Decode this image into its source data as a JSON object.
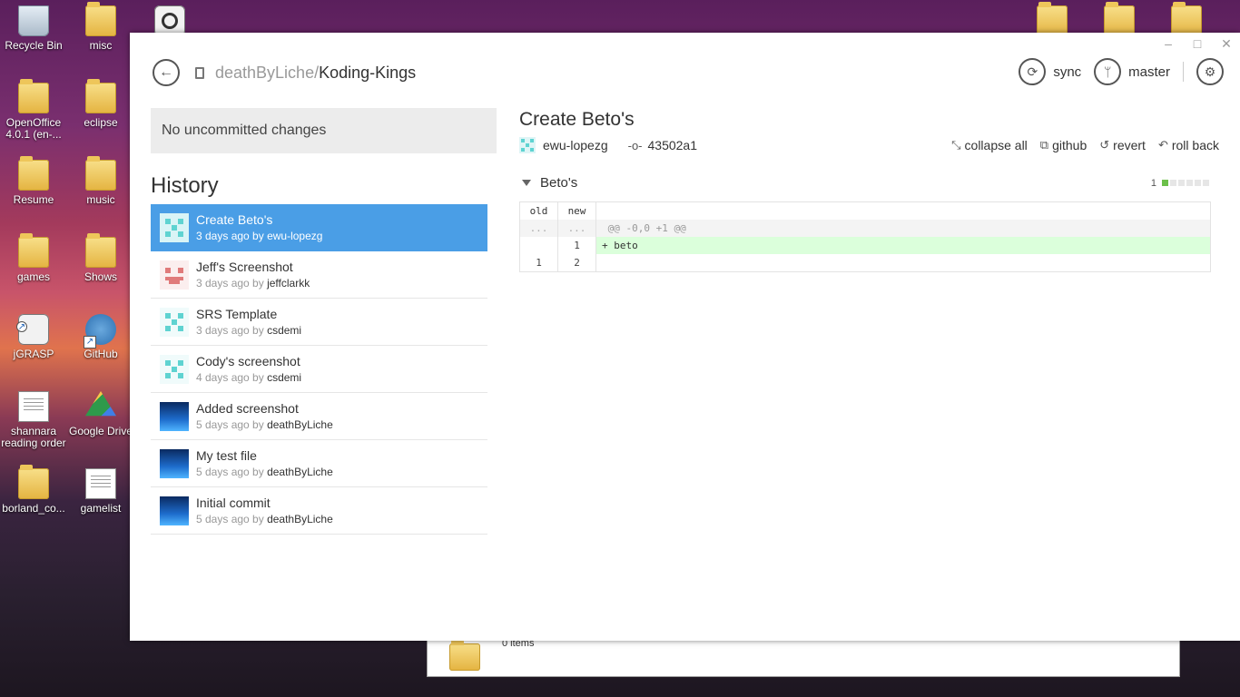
{
  "desktop": {
    "icons": [
      {
        "label": "Recycle Bin"
      },
      {
        "label": "misc"
      },
      {
        "label": "OpenOffice 4.0.1 (en-..."
      },
      {
        "label": "eclipse"
      },
      {
        "label": "Resume"
      },
      {
        "label": "music"
      },
      {
        "label": "games"
      },
      {
        "label": "Shows"
      },
      {
        "label": "jGRASP"
      },
      {
        "label": "GitHub"
      },
      {
        "label": "shannara reading order"
      },
      {
        "label": "Google Drive"
      },
      {
        "label": "borland_co..."
      },
      {
        "label": "gamelist"
      }
    ],
    "explorer_status": "0 items"
  },
  "app": {
    "window_controls": {
      "minimize": "–",
      "maximize": "□",
      "close": "✕"
    },
    "repo": {
      "owner": "deathByLiche",
      "separator": "/",
      "name": "Koding-Kings"
    },
    "toolbar": {
      "sync_label": "sync",
      "branch_label": "master"
    },
    "uncommitted": "No uncommitted changes",
    "history_heading": "History",
    "history": [
      {
        "title": "Create Beto's",
        "time": "3 days ago by ",
        "author": "ewu-lopezg",
        "selected": true
      },
      {
        "title": "Jeff's Screenshot",
        "time": "3 days ago by ",
        "author": "jeffclarkk"
      },
      {
        "title": "SRS Template",
        "time": "3 days ago by ",
        "author": "csdemi"
      },
      {
        "title": "Cody's screenshot",
        "time": "4 days ago by ",
        "author": "csdemi"
      },
      {
        "title": "Added screenshot",
        "time": "5 days ago by ",
        "author": "deathByLiche"
      },
      {
        "title": "My test file",
        "time": "5 days ago by ",
        "author": "deathByLiche"
      },
      {
        "title": "Initial commit",
        "time": "5 days ago by ",
        "author": "deathByLiche"
      }
    ],
    "commit": {
      "title": "Create Beto's",
      "author": "ewu-lopezg",
      "sha": "43502a1",
      "actions": {
        "collapse": "collapse all",
        "github": "github",
        "revert": "revert",
        "rollback": "roll back"
      }
    },
    "file": {
      "name": "Beto's",
      "additions": "1",
      "diff_header": {
        "old": "old",
        "new": "new"
      },
      "hunk": {
        "old": "...",
        "new": "...",
        "text": " @@ -0,0 +1 @@"
      },
      "lines": [
        {
          "old": "",
          "new": "1",
          "text": "+ beto"
        },
        {
          "old": "1",
          "new": "2",
          "text": ""
        }
      ]
    }
  }
}
